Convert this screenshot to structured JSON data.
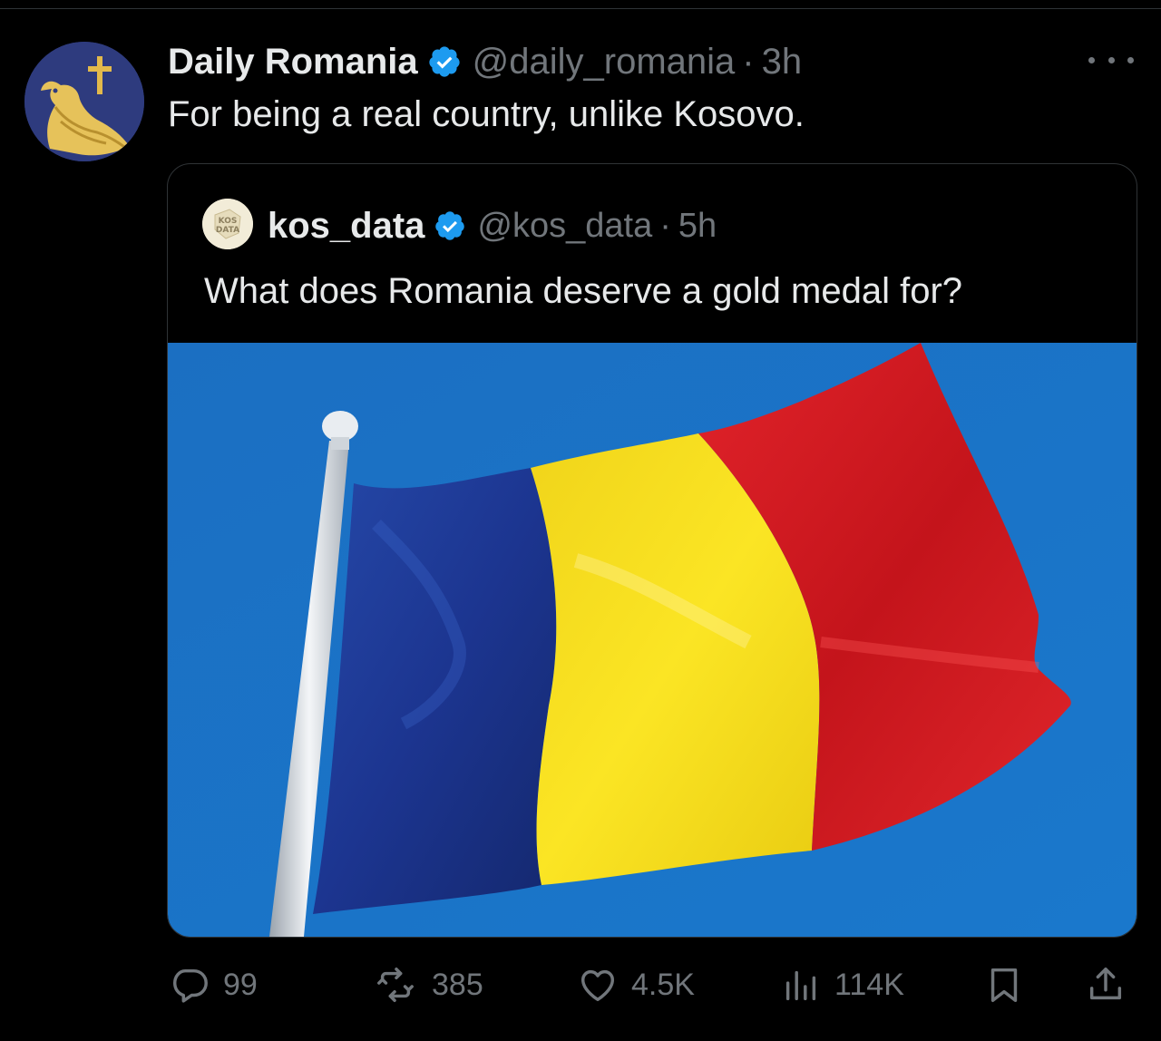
{
  "tweet": {
    "display_name": "Daily Romania",
    "handle": "@daily_romania",
    "separator": "·",
    "time": "3h",
    "text": "For being a real country, unlike Kosovo.",
    "avatar_icon": "eagle-cross-icon",
    "verified_icon": "verified-badge-icon"
  },
  "quoted_tweet": {
    "display_name": "kos_data",
    "handle": "@kos_data",
    "separator": "·",
    "time": "5h",
    "text": "What does Romania deserve a gold medal for?",
    "avatar_label": "KOS DATA",
    "media": "romanian-flag-photo"
  },
  "actions": {
    "replies": "99",
    "reposts": "385",
    "likes": "4.5K",
    "views": "114K"
  },
  "colors": {
    "background": "#000000",
    "text_primary": "#e7e9ea",
    "text_secondary": "#71767b",
    "verified_blue": "#1d9bf0",
    "flag_blue": "#1f3a93",
    "flag_yellow": "#f3dc17",
    "flag_red": "#d81a1f",
    "sky": "#1a73c6"
  }
}
